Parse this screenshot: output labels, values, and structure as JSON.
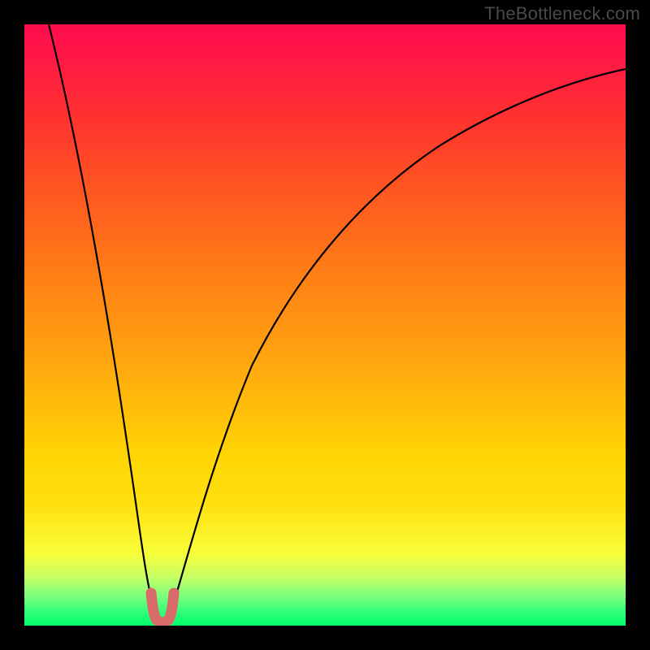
{
  "watermark": "TheBottleneck.com",
  "chart_data": {
    "type": "line",
    "title": "",
    "xlabel": "",
    "ylabel": "",
    "xlim": [
      0,
      100
    ],
    "ylim": [
      0,
      100
    ],
    "gradient_stops": [
      {
        "pos": 0,
        "color": "#ff0b4d"
      },
      {
        "pos": 0.15,
        "color": "#ff3030"
      },
      {
        "pos": 0.4,
        "color": "#ff7a16"
      },
      {
        "pos": 0.72,
        "color": "#ffd604"
      },
      {
        "pos": 0.88,
        "color": "#f7ff3a"
      },
      {
        "pos": 0.95,
        "color": "#7dff7d"
      },
      {
        "pos": 1.0,
        "color": "#00ff6c"
      }
    ],
    "series": [
      {
        "name": "main-curve",
        "color": "#000000",
        "x": [
          4,
          6,
          8,
          10,
          12,
          14,
          16,
          18,
          20,
          21,
          22,
          23,
          24,
          25,
          26,
          28,
          30,
          34,
          38,
          44,
          50,
          58,
          66,
          74,
          82,
          90,
          100
        ],
        "y": [
          100,
          91,
          82,
          73,
          64,
          55,
          46,
          36,
          22,
          12,
          5,
          2,
          2,
          5,
          12,
          24,
          34,
          48,
          57,
          66,
          72,
          78,
          82,
          85,
          87.5,
          89.5,
          91
        ]
      },
      {
        "name": "highlight-segment",
        "color": "#d86a6a",
        "x": [
          21.2,
          21.6,
          22.0,
          22.4,
          22.8,
          23.2,
          23.6,
          24.0,
          24.4,
          24.8
        ],
        "y": [
          6,
          2.5,
          1.2,
          1,
          1,
          1.2,
          2.5,
          6,
          6,
          6
        ]
      }
    ]
  }
}
